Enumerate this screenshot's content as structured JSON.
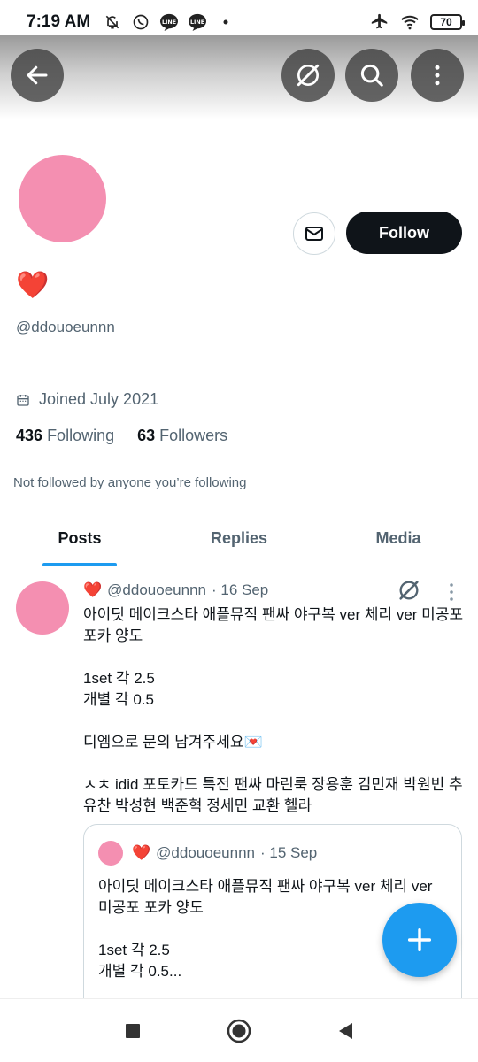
{
  "status_bar": {
    "time": "7:19 AM",
    "battery": "70"
  },
  "profile": {
    "display_name": "❤️",
    "handle": "@ddouoeunnn",
    "joined": "Joined July 2021",
    "following_count": "436",
    "following_label": "Following",
    "followers_count": "63",
    "followers_label": "Followers",
    "not_followed_text": "Not followed by anyone you’re following",
    "follow_button": "Follow",
    "avatar_color": "#f48fb1"
  },
  "tabs": [
    {
      "label": "Posts",
      "active": true
    },
    {
      "label": "Replies",
      "active": false
    },
    {
      "label": "Media",
      "active": false
    }
  ],
  "post": {
    "name": "❤️",
    "handle": "@ddouoeunnn",
    "date": "· 16 Sep",
    "text": "아이딧 메이크스타 애플뮤직 팬싸 야구복 ver 체리 ver 미공포 포카 양도\n\n1set 각 2.5\n개별 각 0.5\n\n디엠으로 문의 남겨주세요💌\n\nㅅㅊ idid 포토카드 특전 팬싸 마린룩 장용훈 김민재 박원빈 추유찬 박성현 백준혁 정세민 교환 헬라",
    "quote": {
      "name": "❤️",
      "handle": "@ddouoeunnn",
      "date": "· 15 Sep",
      "text": "아이딧 메이크스타 애플뮤직 팬싸 야구복 ver 체리 ver 미공포 포카 양도\n\n1set 각 2.5\n개별 각 0.5..."
    }
  },
  "colors": {
    "accent": "#1d9bf0",
    "follow_bg": "#0f1419",
    "secondary_text": "#536471"
  }
}
